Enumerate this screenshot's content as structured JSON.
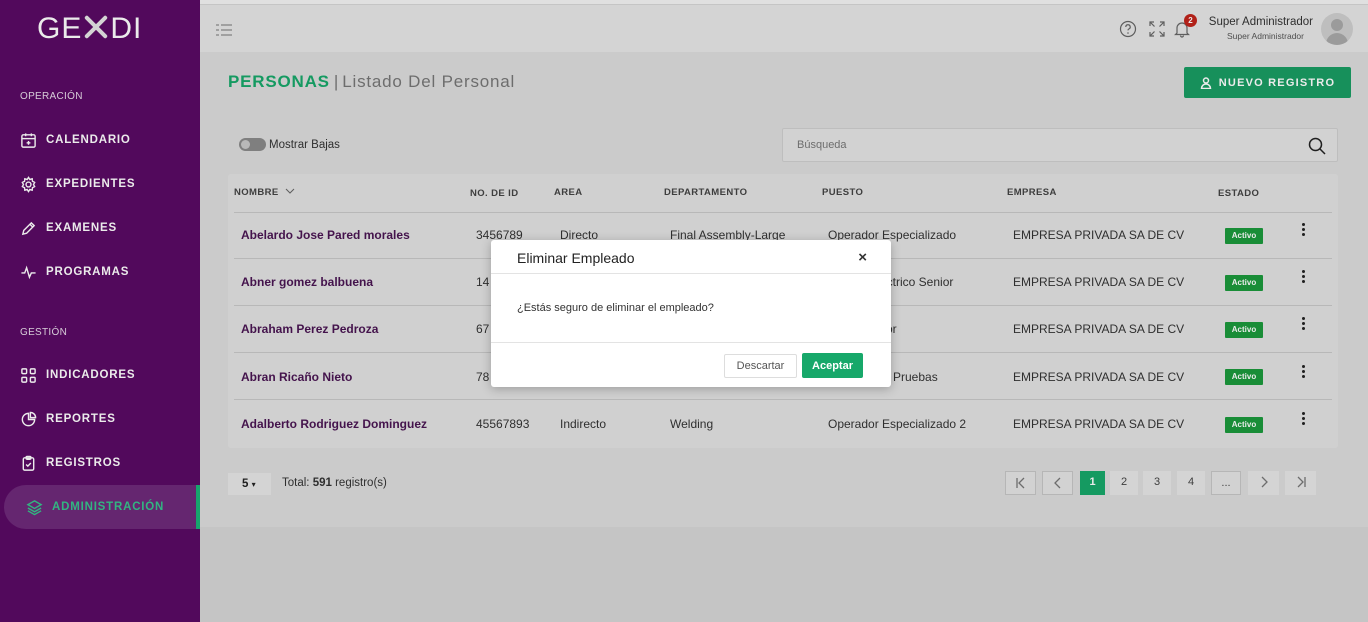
{
  "brand": {
    "logo_left": "GE",
    "logo_right": "DI"
  },
  "sidebar": {
    "sections": [
      {
        "title": "OPERACIÓN"
      },
      {
        "title": "GESTIÓN"
      }
    ],
    "items": [
      {
        "label": "CALENDARIO",
        "icon": "calendar-icon"
      },
      {
        "label": "EXPEDIENTES",
        "icon": "gear-icon"
      },
      {
        "label": "EXAMENES",
        "icon": "pencil-icon"
      },
      {
        "label": "PROGRAMAS",
        "icon": "pulse-icon"
      },
      {
        "label": "INDICADORES",
        "icon": "grid-icon"
      },
      {
        "label": "REPORTES",
        "icon": "pie-chart-icon"
      },
      {
        "label": "REGISTROS",
        "icon": "clipboard-icon"
      },
      {
        "label": "ADMINISTRACIÓN",
        "icon": "layers-icon",
        "active": true
      }
    ]
  },
  "header": {
    "notification_count": "2",
    "user_name": "Super Administrador",
    "user_role": "Super Administrador"
  },
  "page": {
    "title": "PERSONAS",
    "separator": "|",
    "subtitle": "Listado Del Personal",
    "new_button": "NUEVO REGISTRO",
    "toggle_label": "Mostrar Bajas",
    "search_placeholder": "Búsqueda"
  },
  "table": {
    "headers": [
      "NOMBRE",
      "NO. DE ID",
      "AREA",
      "DEPARTAMENTO",
      "PUESTO",
      "EMPRESA",
      "ESTADO"
    ],
    "rows": [
      {
        "nombre": "Abelardo Jose Pared morales",
        "id": "3456789",
        "area": "Directo",
        "departamento": "Final Assembly-Large",
        "puesto": "Operador Especializado",
        "empresa": "EMPRESA PRIVADA SA DE CV",
        "estado": "Activo"
      },
      {
        "nombre": "Abner gomez balbuena",
        "id": "14",
        "area": "",
        "departamento": "",
        "puesto": "ectrico Senior",
        "empresa": "EMPRESA PRIVADA SA DE CV",
        "estado": "Activo"
      },
      {
        "nombre": "Abraham Perez Pedroza",
        "id": "67",
        "area": "",
        "departamento": "",
        "puesto": "or",
        "empresa": "EMPRESA PRIVADA SA DE CV",
        "estado": "Activo"
      },
      {
        "nombre": "Abran Ricaño Nieto",
        "id": "78",
        "area": "",
        "departamento": "",
        "puesto": "e Pruebas",
        "empresa": "EMPRESA PRIVADA SA DE CV",
        "estado": "Activo"
      },
      {
        "nombre": "Adalberto Rodriguez Dominguez",
        "id": "45567893",
        "area": "Indirecto",
        "departamento": "Welding",
        "puesto": "Operador Especializado 2",
        "empresa": "EMPRESA PRIVADA SA DE CV",
        "estado": "Activo"
      }
    ]
  },
  "pagination": {
    "page_size": "5",
    "total_label": "Total:",
    "total_count": "591",
    "total_suffix": "registro(s)",
    "pages": [
      "1",
      "2",
      "3",
      "4",
      "..."
    ],
    "current": "1"
  },
  "modal": {
    "title": "Eliminar Empleado",
    "close": "×",
    "message": "¿Estás seguro de eliminar el empleado?",
    "discard": "Descartar",
    "accept": "Aceptar"
  },
  "colors": {
    "sidebar": "#5a0a64",
    "accent": "#17a86a",
    "badge": "#1c9a3c"
  }
}
